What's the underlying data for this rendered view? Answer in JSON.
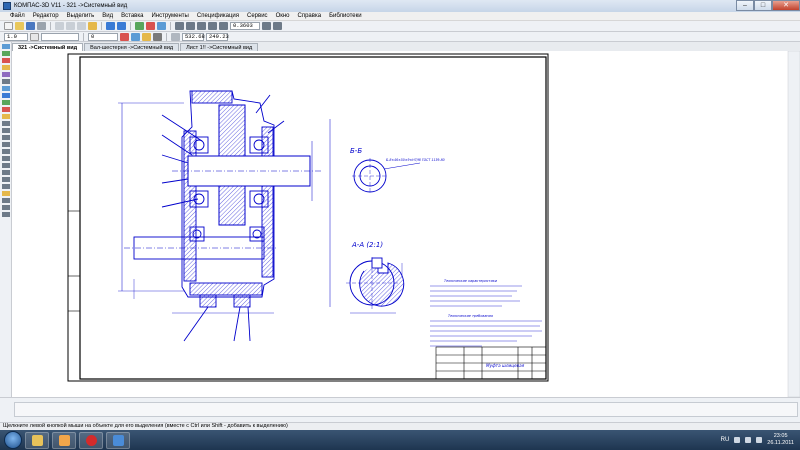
{
  "window": {
    "title": "КОМПАС-3D V11 - 321 ->Системный вид"
  },
  "menu": [
    "Файл",
    "Редактор",
    "Выделить",
    "Вид",
    "Вставка",
    "Инструменты",
    "Спецификация",
    "Сервис",
    "Окно",
    "Справка",
    "Библиотеки"
  ],
  "toolbar": {
    "zoom_value": "0.3603",
    "layer_value": "1.0",
    "state_value": "0",
    "coord_x": "532.68",
    "coord_y": "249.23"
  },
  "doc_tabs": [
    {
      "label": "321 ->Системный вид",
      "active": true
    },
    {
      "label": "Вал-шестерня ->Системный вид",
      "active": false
    },
    {
      "label": "Лист 1!! ->Системный вид",
      "active": false
    }
  ],
  "drawing": {
    "section_bb": "Б-Б",
    "section_aa": "А-А (2:1)",
    "spline_note": "Б-8×46×50×9×Н7/f8 ГОСТ 1139-80",
    "stamp_title": "Муфта шлицевая",
    "tech_heading": "Технические характеристики",
    "tech_req_heading": "Технические требования"
  },
  "status": {
    "hint": "Щелкните левой кнопкой мыши на объекте для его выделения (вместе с Ctrl или Shift - добавить к выделению)"
  },
  "taskbar": {
    "lang": "RU",
    "time": "23:05",
    "date": "26.11.2011"
  },
  "colors": {
    "drawing_line": "#0000cc",
    "hatch": "#0000cc",
    "accent": "#2c67b3"
  }
}
